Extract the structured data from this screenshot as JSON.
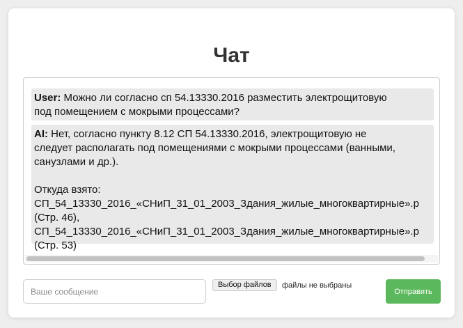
{
  "page": {
    "title": "Чат"
  },
  "chat": {
    "messages": [
      {
        "role": "User",
        "lines": [
          "Можно ли согласно сп 54.13330.2016 разместить электрощитовую",
          "под помещением с мокрыми процессами?"
        ]
      },
      {
        "role": "AI",
        "lines": [
          "Нет, согласно пункту 8.12 СП 54.13330.2016, электрощитовую не",
          "следует располагать под помещениями с мокрыми процессами (ванными,",
          "санузлами и др.).",
          "",
          "Откуда взято:",
          "СП_54_13330_2016_«СНиП_31_01_2003_Здания_жилые_многоквартирные».p",
          "(Стр. 46),",
          "СП_54_13330_2016_«СНиП_31_01_2003_Здания_жилые_многоквартирные».p",
          "(Стр. 53)"
        ]
      }
    ]
  },
  "composer": {
    "placeholder": "Ваше сообщение",
    "file_button_label": "Выбор файлов",
    "file_status": "файлы не выбраны",
    "send_label": "Отправить"
  },
  "colors": {
    "send_button": "#5cb85c",
    "message_background": "#e9e9e9"
  }
}
